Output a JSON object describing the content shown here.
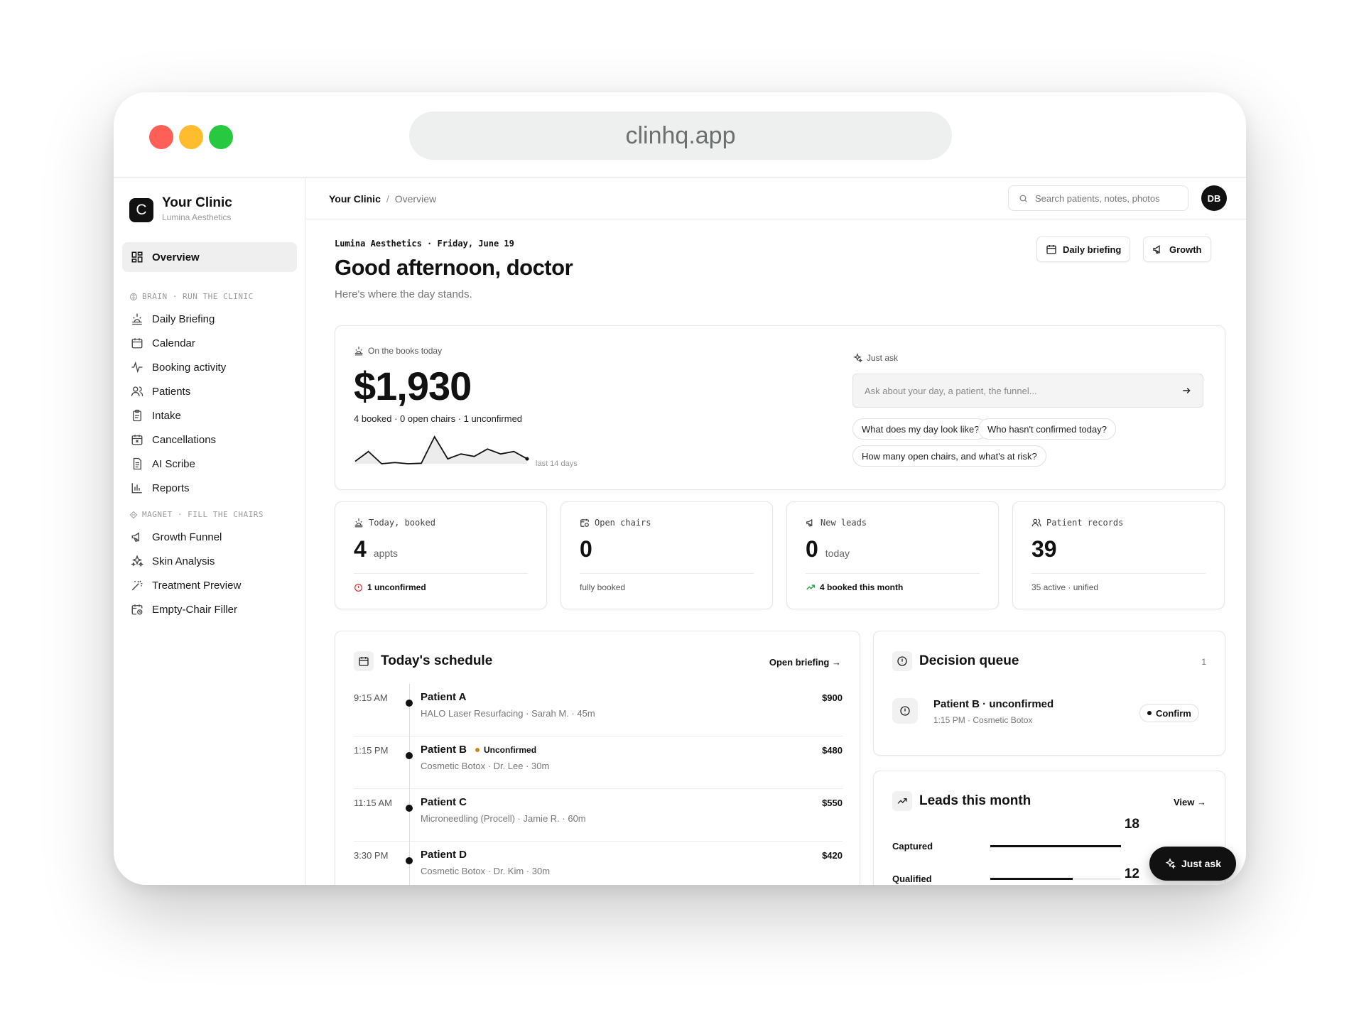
{
  "browser": {
    "url": "clinhq.app",
    "colors": {
      "close": "#fe5f57",
      "minimize": "#febc2e",
      "maximize": "#28c840"
    }
  },
  "sidebar": {
    "logo_letter": "C",
    "clinic_name": "Your Clinic",
    "clinic_subtitle": "Lumina Aesthetics",
    "overview": "Overview",
    "section_brain": "BRAIN · RUN THE CLINIC",
    "brain_items": [
      {
        "label": "Daily Briefing",
        "icon": "sunrise-icon"
      },
      {
        "label": "Calendar",
        "icon": "calendar-icon"
      },
      {
        "label": "Booking activity",
        "icon": "activity-icon"
      },
      {
        "label": "Patients",
        "icon": "users-icon"
      },
      {
        "label": "Intake",
        "icon": "clipboard-icon"
      },
      {
        "label": "Cancellations",
        "icon": "calendar-x-icon"
      },
      {
        "label": "AI Scribe",
        "icon": "document-icon"
      },
      {
        "label": "Reports",
        "icon": "bar-chart-icon"
      }
    ],
    "section_magnet": "MAGNET · FILL THE CHAIRS",
    "magnet_items": [
      {
        "label": "Growth Funnel",
        "icon": "megaphone-icon"
      },
      {
        "label": "Skin Analysis",
        "icon": "sparkles-icon"
      },
      {
        "label": "Treatment Preview",
        "icon": "wand-icon"
      },
      {
        "label": "Empty-Chair Filler",
        "icon": "calendar-clock-icon"
      }
    ]
  },
  "topbar": {
    "breadcrumb_root": "Your Clinic",
    "breadcrumb_sep": "/",
    "breadcrumb_current": "Overview",
    "search_placeholder": "Search patients, notes, photos",
    "avatar_initials": "DB"
  },
  "header": {
    "eyebrow": "Lumina Aesthetics · Friday, June 19",
    "greeting": "Good afternoon, doctor",
    "subtitle": "Here's where the day stands.",
    "btn_briefing": "Daily briefing",
    "btn_growth": "Growth"
  },
  "hero": {
    "label": "On the books today",
    "value": "$1,930",
    "summary": "4 booked · 0 open chairs · 1 unconfirmed",
    "spark_label": "last 14 days",
    "spark_values": [
      2,
      6,
      1,
      1.5,
      1,
      1.2,
      12,
      3,
      5,
      4,
      7,
      5,
      6,
      3
    ]
  },
  "ask": {
    "label": "Just ask",
    "placeholder": "Ask about your day, a patient, the funnel...",
    "suggestions": [
      "What does my day look like?",
      "Who hasn't confirmed today?",
      "How many open chairs, and what's at risk?"
    ]
  },
  "stats": [
    {
      "label": "Today, booked",
      "value": "4",
      "unit": "appts",
      "foot": "1 unconfirmed",
      "icon": "sunrise-icon"
    },
    {
      "label": "Open chairs",
      "value": "0",
      "unit": "",
      "foot": "fully booked",
      "icon": "calendar-clock-icon"
    },
    {
      "label": "New leads",
      "value": "0",
      "unit": "today",
      "foot": "4 booked this month",
      "icon": "megaphone-icon"
    },
    {
      "label": "Patient records",
      "value": "39",
      "unit": "",
      "foot": "35 active · unified",
      "icon": "users-icon"
    }
  ],
  "schedule": {
    "title": "Today's schedule",
    "link": "Open briefing →",
    "rows": [
      {
        "time": "9:15 AM",
        "name": "Patient A",
        "status": "",
        "detail": "HALO Laser Resurfacing · Sarah M. · 45m",
        "price": "$900"
      },
      {
        "time": "1:15 PM",
        "name": "Patient B",
        "status": "Unconfirmed",
        "detail": "Cosmetic Botox · Dr. Lee · 30m",
        "price": "$480"
      },
      {
        "time": "11:15 AM",
        "name": "Patient C",
        "status": "",
        "detail": "Microneedling (Procell) · Jamie R. · 60m",
        "price": "$550"
      },
      {
        "time": "3:30 PM",
        "name": "Patient D",
        "status": "",
        "detail": "Cosmetic Botox · Dr. Kim · 30m",
        "price": "$420"
      }
    ]
  },
  "decision_queue": {
    "title": "Decision queue",
    "count": "1",
    "item_title": "Patient B · unconfirmed",
    "item_detail": "1:15 PM · Cosmetic Botox",
    "action": "Confirm"
  },
  "leads": {
    "title": "Leads this month",
    "link": "View →",
    "rows": [
      {
        "label": "Captured",
        "value": "18",
        "fraction": 1.0
      },
      {
        "label": "Qualified",
        "value": "12",
        "fraction": 0.63
      }
    ]
  },
  "fab_label": "Just ask"
}
